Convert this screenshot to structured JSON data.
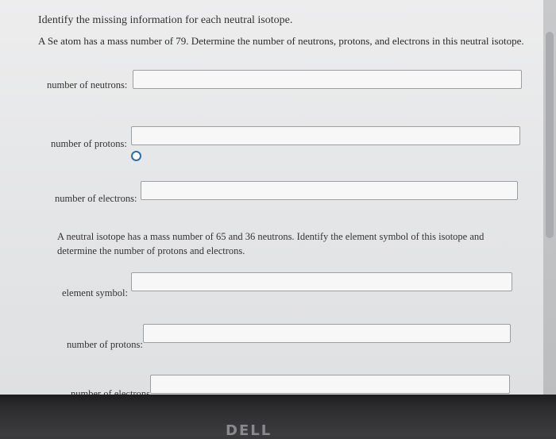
{
  "header": {
    "title": "Identify the missing information for each neutral isotope."
  },
  "question1": {
    "prompt": "A Se atom has a mass number of 79. Determine the number of neutrons, protons, and electrons in this neutral isotope.",
    "fields": [
      {
        "label": "number of neutrons:",
        "value": ""
      },
      {
        "label": "number of protons:",
        "value": ""
      },
      {
        "label": "number of electrons:",
        "value": ""
      }
    ]
  },
  "question2": {
    "prompt": "A neutral isotope has a mass number of 65 and 36 neutrons. Identify the element symbol of this isotope and determine the number of protons and electrons.",
    "fields": [
      {
        "label": "element symbol:",
        "value": ""
      },
      {
        "label": "number of protons:",
        "value": ""
      },
      {
        "label": "number of electrons:",
        "value": ""
      }
    ]
  },
  "bezel": {
    "logo": "DELL"
  },
  "colors": {
    "page_bg": "#e6e7e8",
    "bezel": "#2c2c2e",
    "input_border": "#9c9ea1"
  }
}
